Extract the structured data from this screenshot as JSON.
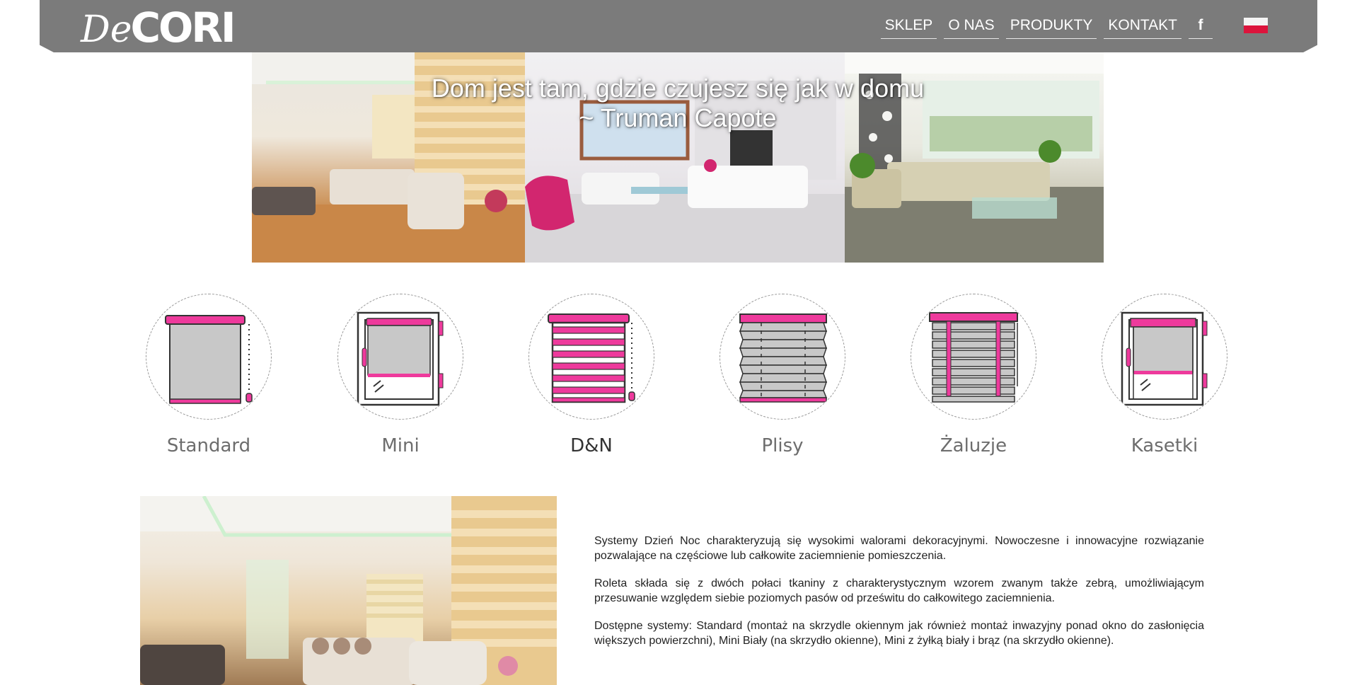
{
  "header": {
    "logo_de": "De",
    "logo_cori": "CORI",
    "nav": [
      "SKLEP",
      "O NAS",
      "PRODUKTY",
      "KONTAKT"
    ],
    "facebook": "f",
    "flag": "polish-flag-icon"
  },
  "hero": {
    "quote_line1": "Dom jest tam, gdzie czujesz się jak w domu",
    "quote_line2": "~ Truman Capote"
  },
  "products": [
    {
      "label": "Standard",
      "icon": "standard-roller-blind-icon"
    },
    {
      "label": "Mini",
      "icon": "mini-roller-blind-icon"
    },
    {
      "label": "D&N",
      "icon": "day-night-blind-icon",
      "active": true
    },
    {
      "label": "Plisy",
      "icon": "pleated-blind-icon"
    },
    {
      "label": "Żaluzje",
      "icon": "venetian-blind-icon"
    },
    {
      "label": "Kasetki",
      "icon": "cassette-blind-icon"
    }
  ],
  "description": {
    "p1": "Systemy Dzień Noc charakteryzują się wysokimi walorami dekoracyjnymi. Nowoczesne i innowacyjne rozwiązanie pozwalające na częściowe lub całkowite zaciemnienie pomieszczenia.",
    "p2": "Roleta składa się z dwóch połaci tkaniny z charakterystycznym wzorem zwanym także zebrą, umożliwiającym przesuwanie względem siebie poziomych pasów od prześwitu do całkowitego zaciemnienia.",
    "p3": "Dostępne systemy: Standard (montaż na skrzydle okiennym jak również montaż inwazyjny ponad okno do zasłonięcia większych powierzchni), Mini Biały (na skrzydło okienne), Mini z żyłką biały i brąz (na skrzydło okienne)."
  },
  "colors": {
    "header_bg": "#7b7b7b",
    "accent_pink": "#ee3a9c",
    "text_gray": "#6d6d6d"
  }
}
